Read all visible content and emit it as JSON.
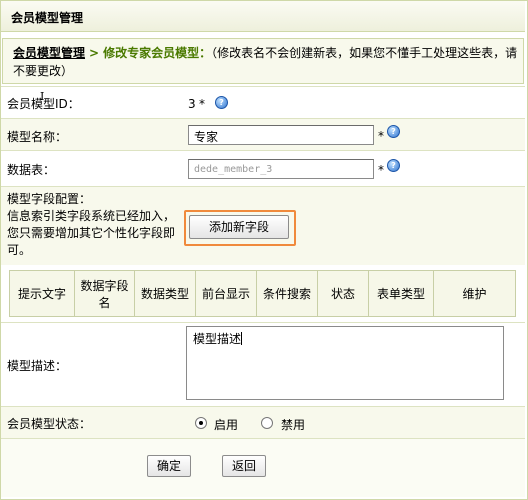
{
  "header": {
    "title": "会员模型管理"
  },
  "breadcrumb": {
    "root": "会员模型管理",
    "separator": ">",
    "current": "修改专家会员模型：",
    "note": "（修改表名不会创建新表，如果您不懂手工处理这些表，请不要更改）"
  },
  "form": {
    "model_id": {
      "label": "会员模型ID：",
      "value": "3",
      "star": "*"
    },
    "model_name": {
      "label": "模型名称：",
      "value": "专家",
      "star": "*"
    },
    "data_table": {
      "label": "数据表：",
      "value": "dede_member_3",
      "star": "*"
    },
    "field_config": {
      "label": "模型字段配置：",
      "description": "信息索引类字段系统已经加入，您只需要增加其它个性化字段即可。",
      "add_button": "添加新字段"
    },
    "fields_table": {
      "headers": [
        "提示文字",
        "数据字段名",
        "数据类型",
        "前台显示",
        "条件搜索",
        "状态",
        "表单类型",
        "维护"
      ]
    },
    "description": {
      "label": "模型描述：",
      "value": "模型描述"
    },
    "status": {
      "label": "会员模型状态：",
      "options": [
        "启用",
        "禁用"
      ],
      "selected": "启用"
    }
  },
  "actions": {
    "confirm": "确定",
    "back": "返回"
  }
}
